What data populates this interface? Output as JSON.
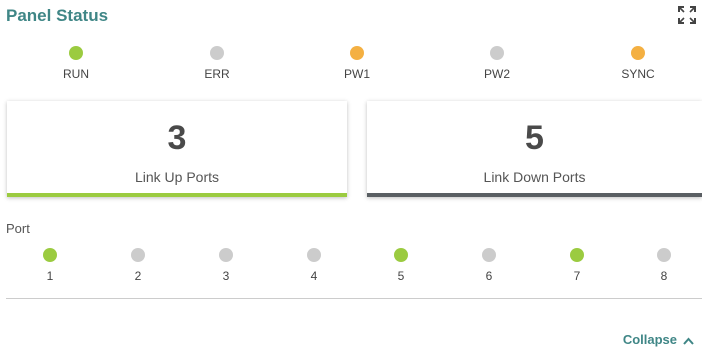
{
  "header": {
    "title": "Panel Status",
    "expand_icon": "fullscreen-icon"
  },
  "colors": {
    "green": "#9bcb40",
    "gray": "#cccccc",
    "amber": "#f4b042",
    "teal": "#3f8686",
    "dark_bar": "#5a5f63"
  },
  "leds": [
    {
      "label": "RUN",
      "status": "green"
    },
    {
      "label": "ERR",
      "status": "gray"
    },
    {
      "label": "PW1",
      "status": "amber"
    },
    {
      "label": "PW2",
      "status": "gray"
    },
    {
      "label": "SYNC",
      "status": "amber"
    }
  ],
  "cards": {
    "up": {
      "count": "3",
      "label": "Link Up Ports"
    },
    "down": {
      "count": "5",
      "label": "Link Down Ports"
    }
  },
  "ports": {
    "title": "Port",
    "items": [
      {
        "num": "1",
        "status": "green"
      },
      {
        "num": "2",
        "status": "gray"
      },
      {
        "num": "3",
        "status": "gray"
      },
      {
        "num": "4",
        "status": "gray"
      },
      {
        "num": "5",
        "status": "green"
      },
      {
        "num": "6",
        "status": "gray"
      },
      {
        "num": "7",
        "status": "green"
      },
      {
        "num": "8",
        "status": "gray"
      }
    ]
  },
  "footer": {
    "collapse_label": "Collapse",
    "collapse_icon": "chevron-up-icon"
  }
}
